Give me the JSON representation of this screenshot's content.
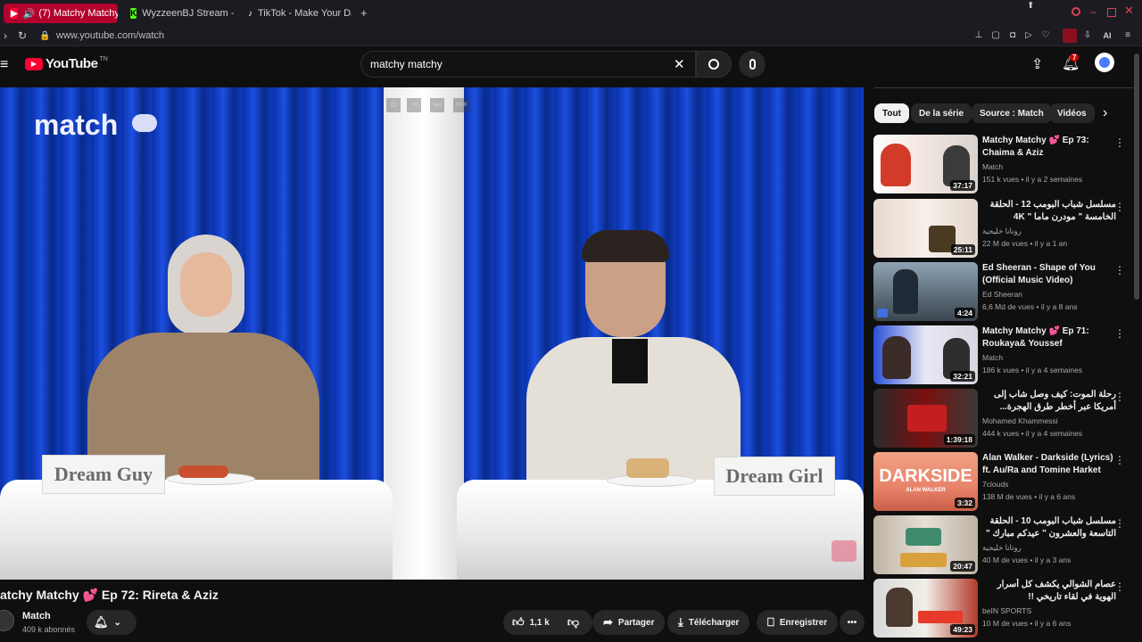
{
  "browser": {
    "tabs": [
      {
        "title": "(7) Matchy Matchy",
        "icon": "youtube-icon",
        "active": true
      },
      {
        "title": "WyzzeenBJ Stream - Wat",
        "icon": "kick-icon",
        "active": false
      },
      {
        "title": "TikTok - Make Your Day",
        "icon": "tiktok-icon",
        "active": false
      }
    ],
    "url": "www.youtube.com/watch",
    "extension_badge": "AI"
  },
  "header": {
    "brand": "YouTube",
    "brand_suffix": "TN",
    "search_query": "matchy matchy",
    "notification_count": "7"
  },
  "player": {
    "logo_text": "match",
    "sign_left": "Dream Guy",
    "sign_right": "Dream Girl"
  },
  "video": {
    "title": "atchy Matchy 💕 Ep 72: Rireta & Aziz",
    "channel": "Match",
    "subscribers": "409 k abonnés",
    "likes": "1,1 k",
    "share_label": "Partager",
    "download_label": "Télécharger",
    "save_label": "Enregistrer"
  },
  "sidebar": {
    "chips": [
      "Tout",
      "De la série",
      "Source : Match",
      "Vidéos"
    ],
    "items": [
      {
        "title": "Matchy Matchy 💕 Ep 73: Chaima & Aziz",
        "channel": "Match",
        "meta": "151 k vues • il y a 2 semaines",
        "duration": "37:17"
      },
      {
        "title": "مسلسل شباب البومب 12 - الحلقة الخامسة \" مودرن ماما \" 4K",
        "channel": "روتانا خليجية",
        "meta": "22 M de vues • il y a 1 an",
        "duration": "25:11"
      },
      {
        "title": "Ed Sheeran - Shape of You (Official Music Video)",
        "channel": "Ed Sheeran",
        "meta": "6,6 Md de vues • il y a 8 ans",
        "duration": "4:24"
      },
      {
        "title": "Matchy Matchy 💕 Ep 71: Roukaya& Youssef",
        "channel": "Match",
        "meta": "186 k vues • il y a 4 semaines",
        "duration": "32:21"
      },
      {
        "title": "رحلة الموت: كيف وصل شاب إلى أمريكا عبر أخطر طرق الهجرة...",
        "channel": "Mohamed Khammessi",
        "meta": "444 k vues • il y a 4 semaines",
        "duration": "1:39:18"
      },
      {
        "title": "Alan Walker - Darkside (Lyrics) ft. Au/Ra and Tomine Harket",
        "channel": "7clouds",
        "meta": "138 M de vues • il y a 6 ans",
        "duration": "3:32"
      },
      {
        "title": "مسلسل شباب البومب 10 - الحلقة التاسعة والعشرون \" عيدكم مبارك \" 4K",
        "channel": "روتانا خليجية",
        "meta": "40 M de vues • il y a 3 ans",
        "duration": "20:47"
      },
      {
        "title": "عصام الشوالي يكشف كل أسرار الهوية في لقاء تاريخي !!",
        "channel": "beIN SPORTS",
        "meta": "10 M de vues • il y a 6 ans",
        "duration": "49:23"
      }
    ],
    "thumb_labels": {
      "darkside": "DARKSIDE",
      "darkside_sub": "ALAN WALKER"
    }
  },
  "colors": {
    "accent": "#ff0033",
    "tab_active": "#b3002d",
    "curtain": "#0d3bbd"
  }
}
